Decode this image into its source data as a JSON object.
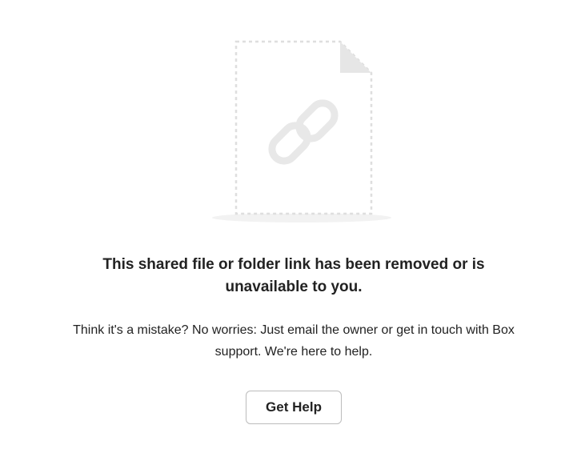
{
  "illustration": {
    "icon": "broken-link-file-icon",
    "page_color": "#e6e6e6",
    "chain_color": "#e8e8e8"
  },
  "error": {
    "title": "This shared file or folder link has been removed or is unavailable to you.",
    "message": "Think it's a mistake? No worries: Just email the owner or get in touch with Box support. We're here to help."
  },
  "actions": {
    "get_help_label": "Get Help"
  }
}
